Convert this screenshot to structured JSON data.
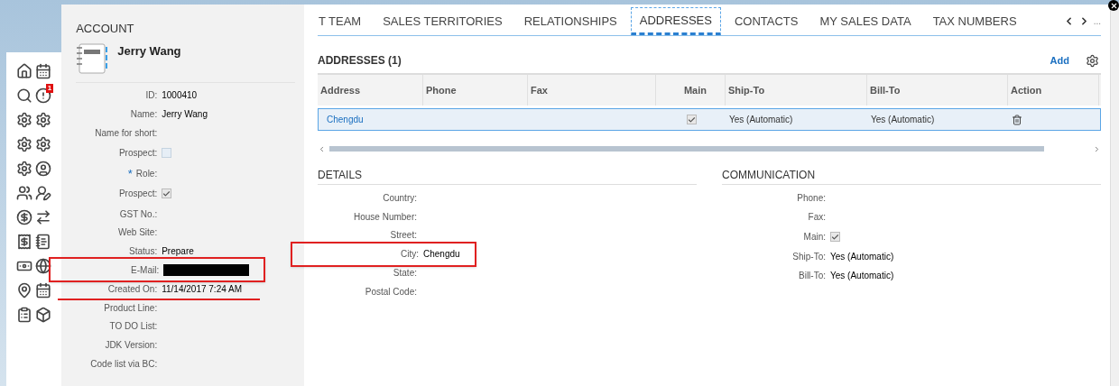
{
  "sidebar": {
    "badge": "1",
    "icons": [
      {
        "kind": "home"
      },
      {
        "kind": "calendar"
      },
      {
        "kind": "search"
      },
      {
        "kind": "alert"
      },
      {
        "kind": "gear"
      },
      {
        "kind": "gear"
      },
      {
        "kind": "gear"
      },
      {
        "kind": "gear"
      },
      {
        "kind": "gear"
      },
      {
        "kind": "user"
      },
      {
        "kind": "list"
      },
      {
        "kind": "contact"
      },
      {
        "kind": "dollar"
      },
      {
        "kind": "transfer"
      },
      {
        "kind": "receipt"
      },
      {
        "kind": "notebook"
      },
      {
        "kind": "bill"
      },
      {
        "kind": "globe"
      },
      {
        "kind": "map"
      },
      {
        "kind": "calendar"
      },
      {
        "kind": "clipboard"
      },
      {
        "kind": "box"
      }
    ]
  },
  "account": {
    "section": "ACCOUNT",
    "name": "Jerry Wang",
    "fields": [
      {
        "label": "ID:",
        "kind": "text",
        "value": "1000410"
      },
      {
        "label": "Name:",
        "kind": "text",
        "value": "Jerry Wang"
      },
      {
        "label": "Name for short:",
        "kind": "text"
      },
      {
        "label": "Prospect:",
        "kind": "checkbox",
        "checked": false
      },
      {
        "label": "Role:",
        "kind": "text",
        "required_mark": "*"
      },
      {
        "label": "Prospect:",
        "kind": "checkbox",
        "checked": true
      },
      {
        "label": "GST No.:",
        "kind": "text"
      },
      {
        "label": "Web Site:",
        "kind": "text"
      },
      {
        "label": "Status:",
        "kind": "text",
        "value": "Prepare"
      },
      {
        "label": "E-Mail:",
        "kind": "redacted",
        "highlight": {
          "kind": "box"
        }
      },
      {
        "label": "Created On:",
        "kind": "text",
        "value": "11/14/2017 7:24 AM",
        "highlight": {
          "kind": "underline"
        }
      },
      {
        "label": "Product Line:",
        "kind": "text"
      },
      {
        "label": "TO DO List:",
        "kind": "text"
      },
      {
        "label": "JDK Version:",
        "kind": "text"
      },
      {
        "label": "Code list via BC:",
        "kind": "text"
      }
    ]
  },
  "tabs": [
    {
      "label": "T TEAM",
      "selected": false
    },
    {
      "label": "SALES TERRITORIES",
      "selected": false
    },
    {
      "label": "RELATIONSHIPS",
      "selected": false
    },
    {
      "label": "ADDRESSES",
      "selected": true
    },
    {
      "label": "CONTACTS",
      "selected": false
    },
    {
      "label": "MY SALES DATA",
      "selected": false
    },
    {
      "label": "TAX NUMBERS",
      "selected": false
    }
  ],
  "tab_overflow": "...",
  "addresses": {
    "title": "ADDRESSES (1)",
    "add": "Add",
    "columns": [
      "Address",
      "Phone",
      "Fax",
      "Main",
      "Ship-To",
      "Bill-To",
      "Action"
    ],
    "rows": [
      {
        "address": "Chengdu",
        "main": true,
        "ship_to": "Yes (Automatic)",
        "bill_to": "Yes (Automatic)",
        "selected": true
      }
    ]
  },
  "details": {
    "title": "DETAILS",
    "fields": [
      {
        "label": "Country:",
        "kind": "text"
      },
      {
        "label": "House Number:",
        "kind": "text"
      },
      {
        "label": "Street:",
        "kind": "text"
      },
      {
        "label": "City:",
        "kind": "text",
        "value": "Chengdu",
        "highlight": {
          "kind": "box"
        }
      },
      {
        "label": "State:",
        "kind": "text"
      },
      {
        "label": "Postal Code:",
        "kind": "text"
      }
    ]
  },
  "communication": {
    "title": "COMMUNICATION",
    "fields": [
      {
        "label": "Phone:",
        "kind": "text"
      },
      {
        "label": "Fax:",
        "kind": "text"
      },
      {
        "label": "Main:",
        "kind": "checkbox",
        "checked": true
      },
      {
        "label": "Ship-To:",
        "kind": "text",
        "value": "Yes (Automatic)"
      },
      {
        "label": "Bill-To:",
        "kind": "text",
        "value": "Yes (Automatic)"
      }
    ]
  }
}
